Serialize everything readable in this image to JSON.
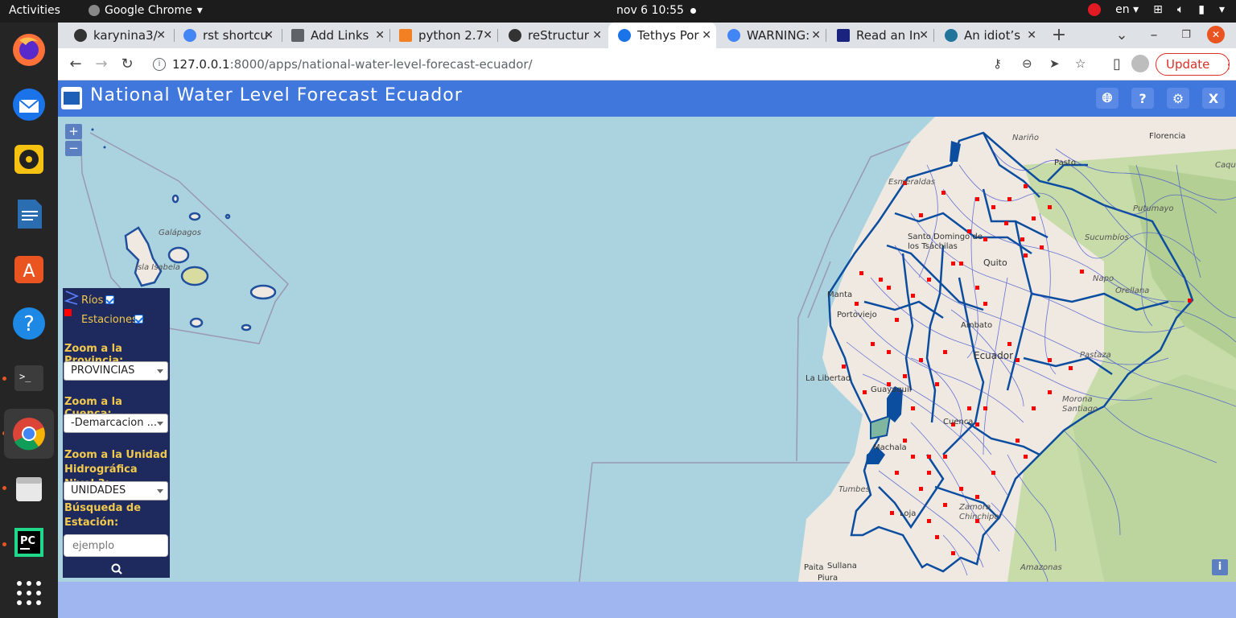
{
  "topbar": {
    "activities": "Activities",
    "app_name": "Google Chrome",
    "clock": "nov 6  10:55",
    "lang": "en"
  },
  "tabs": [
    {
      "label": "karynina3/",
      "color": "#333333"
    },
    {
      "label": "rst shortcu",
      "color": "#4285f4"
    },
    {
      "label": "Add Links",
      "color": "#5f6368"
    },
    {
      "label": "python 2.7",
      "color": "#f48024"
    },
    {
      "label": "reStructur",
      "color": "#333333"
    },
    {
      "label": "Tethys Por",
      "color": "#1a73e8"
    },
    {
      "label": "WARNING:",
      "color": "#4285f4"
    },
    {
      "label": "Read an In",
      "color": "#1a237e"
    },
    {
      "label": "An idiot’s",
      "color": "#21759b"
    }
  ],
  "browser": {
    "url_host": "127.0.0.1",
    "url_path": ":8000/apps/national-water-level-forecast-ecuador/",
    "update_label": "Update"
  },
  "app": {
    "title": "National Water Level Forecast Ecuador",
    "close_label": "X"
  },
  "map": {
    "zoom_in": "+",
    "zoom_out": "−",
    "info": "i",
    "labels": {
      "galapagos": "Galápagos",
      "isla_isabela": "Isla Isabela",
      "narino": "Nariño",
      "florencia": "Florencia",
      "pasto": "Pasto",
      "caqueta": "Caque",
      "putumayo": "Putumayo",
      "sucumbios": "Sucumbíos",
      "santo_domingo": "Santo Domingo de los Tsáchilas",
      "quito": "Quito",
      "napo": "Napo",
      "orellana": "Orellana",
      "manta": "Manta",
      "portoviejo": "Portoviejo",
      "ambato": "Ambato",
      "ecuador": "Ecuador",
      "pastaza": "Pastaza",
      "la_libertad": "La Libertad",
      "guayaquil": "Guayaquil",
      "cuenca": "Cuenca",
      "morona_santiago": "Morona Santiago",
      "machala": "Machala",
      "tumbes": "Tumbes",
      "loja": "Loja",
      "zamora_chinchipe": "Zamora Chinchipe",
      "amazonas": "Amazonas",
      "paita": "Paita",
      "sullana": "Sullana",
      "piura": "Piura",
      "esmeraldas": "Esmeraldas"
    }
  },
  "panel": {
    "rios": "Ríos",
    "estaciones": "Estaciones",
    "zoom_provincia": "Zoom a la Provincia:",
    "provincia_value": "PROVINCIAS",
    "zoom_cuenca": "Zoom a la Cuenca:",
    "cuenca_value": "-Demarcacion ...",
    "zoom_unidad": "Zoom a la Unidad Hidrográfica Nivel 3:",
    "unidad_value": "UNIDADES",
    "busqueda": "Búsqueda de Estación:",
    "search_placeholder": "ejemplo"
  }
}
